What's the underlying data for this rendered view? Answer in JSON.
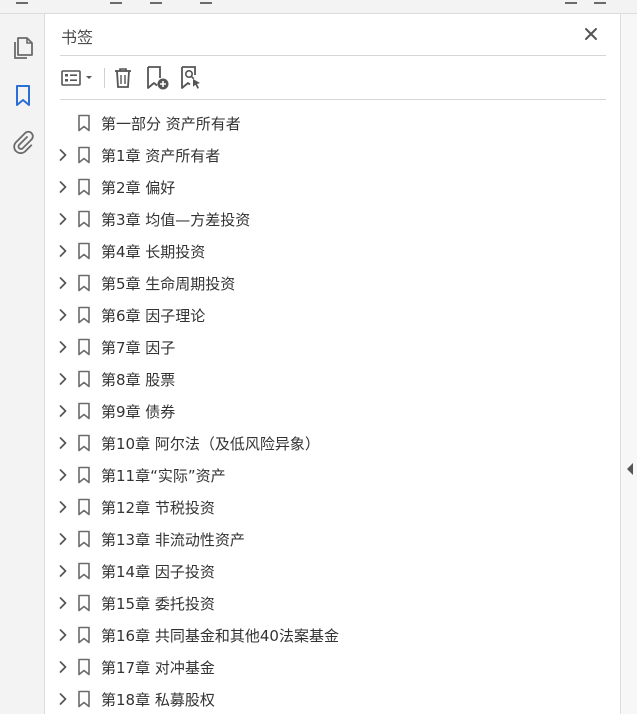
{
  "panel": {
    "title": "书签"
  },
  "left_rail": {
    "items": [
      {
        "icon": "page-thumbnails-icon"
      },
      {
        "icon": "bookmark-icon",
        "active": true
      },
      {
        "icon": "attachment-icon"
      }
    ]
  },
  "toolbar": {
    "buttons": [
      {
        "icon": "options-list-icon"
      },
      {
        "icon": "trash-icon"
      },
      {
        "icon": "add-bookmark-icon"
      },
      {
        "icon": "find-bookmark-icon"
      }
    ]
  },
  "colors": {
    "accent": "#2b6fd6",
    "icon": "#6b6b6b",
    "text": "#333333"
  },
  "bookmarks": [
    {
      "label": "第一部分  资产所有者",
      "expandable": false
    },
    {
      "label": "第1章  资产所有者",
      "expandable": true
    },
    {
      "label": "第2章  偏好",
      "expandable": true
    },
    {
      "label": "第3章  均值—方差投资",
      "expandable": true
    },
    {
      "label": "第4章  长期投资",
      "expandable": true
    },
    {
      "label": "第5章  生命周期投资",
      "expandable": true
    },
    {
      "label": "第6章  因子理论",
      "expandable": true
    },
    {
      "label": "第7章  因子",
      "expandable": true
    },
    {
      "label": "第8章  股票",
      "expandable": true
    },
    {
      "label": "第9章  债券",
      "expandable": true
    },
    {
      "label": "第10章  阿尔法（及低风险异象）",
      "expandable": true
    },
    {
      "label": "第11章“实际”资产",
      "expandable": true
    },
    {
      "label": "第12章  节税投资",
      "expandable": true
    },
    {
      "label": "第13章  非流动性资产",
      "expandable": true
    },
    {
      "label": "第14章  因子投资",
      "expandable": true
    },
    {
      "label": "第15章  委托投资",
      "expandable": true
    },
    {
      "label": "第16章  共同基金和其他40法案基金",
      "expandable": true
    },
    {
      "label": "第17章  对冲基金",
      "expandable": true
    },
    {
      "label": "第18章  私募股权",
      "expandable": true
    }
  ]
}
